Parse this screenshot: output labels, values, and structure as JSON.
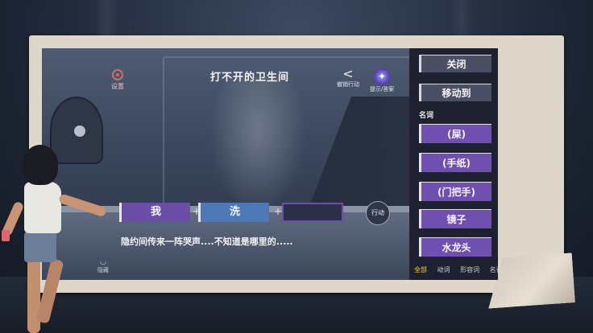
{
  "game": {
    "title": "打不开的卫生间",
    "settings_label": "设置",
    "undo_label": "撤销行动",
    "hint_label": "提示/答案",
    "hide_label": "隐藏",
    "hint_icon_text": "✦"
  },
  "panel": {
    "close_label": "关闭",
    "move_label": "移动到",
    "noun_header": "名词",
    "nouns": [
      "(屎)",
      "(手纸)",
      "(门把手)",
      "镜子",
      "水龙头"
    ],
    "tabs": [
      "全部",
      "动词",
      "形容词",
      "名词"
    ],
    "active_tab": "全部"
  },
  "sentence": {
    "slot1": "我",
    "slot2": "洗",
    "slot3": "",
    "plus": "+",
    "action_label": "行动"
  },
  "subtitle": "隐约间传来一阵哭声....不知道是哪里的....."
}
